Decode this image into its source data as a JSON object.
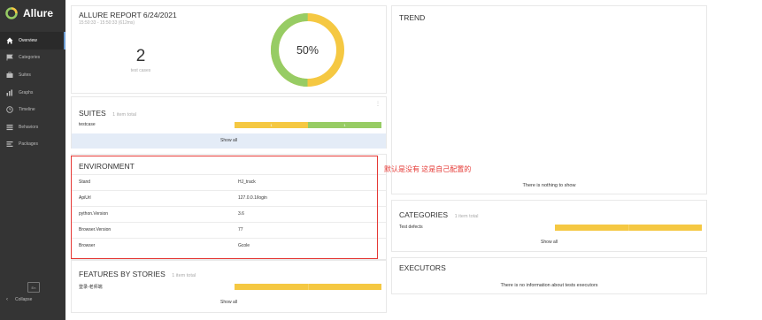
{
  "app": {
    "name": "Allure"
  },
  "sidebar": {
    "items": [
      {
        "label": "Overview",
        "icon": "home-icon"
      },
      {
        "label": "Categories",
        "icon": "flag-icon"
      },
      {
        "label": "Suites",
        "icon": "briefcase-icon"
      },
      {
        "label": "Graphs",
        "icon": "bar-chart-icon"
      },
      {
        "label": "Timeline",
        "icon": "clock-icon"
      },
      {
        "label": "Behaviors",
        "icon": "list-icon"
      },
      {
        "label": "Packages",
        "icon": "align-left-icon"
      }
    ],
    "language": "En",
    "collapse_label": "Collapse"
  },
  "summary": {
    "title": "ALLURE REPORT 6/24/2021",
    "time": "15:50:33 - 15:50:33 (612ms)",
    "count": "2",
    "count_label": "test cases",
    "percent_label": "50%",
    "passed_fraction": 0.5
  },
  "suites": {
    "title": "SUITES",
    "subtitle": "1 item total",
    "rows": [
      {
        "name": "testcase",
        "failed": 1,
        "passed": 1
      }
    ],
    "show_all": "Show all"
  },
  "environment": {
    "title": "ENVIRONMENT",
    "rows": [
      {
        "key": "Stand",
        "value": "HJ_track"
      },
      {
        "key": "ApiUrl",
        "value": "127.0.0.1/login"
      },
      {
        "key": "python.Version",
        "value": "3.6"
      },
      {
        "key": "Browser.Version",
        "value": "77"
      },
      {
        "key": "Browser",
        "value": "Gcole"
      }
    ]
  },
  "features": {
    "title": "FEATURES BY STORIES",
    "subtitle": "1 item total",
    "rows": [
      {
        "name": "登录-老师端"
      }
    ],
    "show_all": "Show all"
  },
  "trend": {
    "title": "TREND",
    "empty": "There is nothing to show"
  },
  "categories": {
    "title": "CATEGORIES",
    "subtitle": "1 item total",
    "rows": [
      {
        "name": "Test defects"
      }
    ],
    "show_all": "Show all"
  },
  "executors": {
    "title": "EXECUTORS",
    "empty": "There is no information about tests executors"
  },
  "annotation": {
    "text": "默认是没有 这是自己配置的"
  },
  "colors": {
    "failed": "#f5c842",
    "passed": "#97cc64",
    "sidebar": "#343434",
    "highlight": "#e53935"
  }
}
